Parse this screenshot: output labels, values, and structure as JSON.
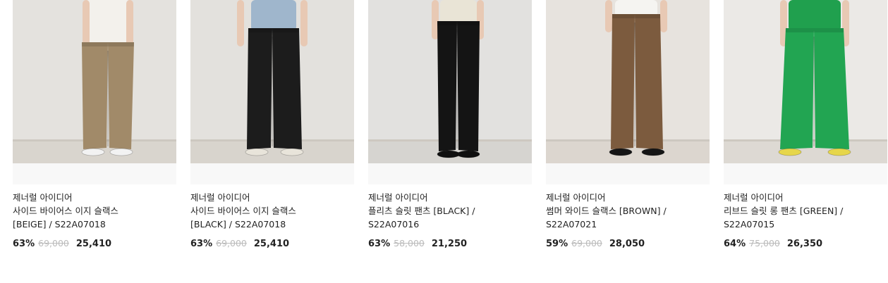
{
  "products": [
    {
      "brand": "제너럴 아이디어",
      "name": "사이드 바이어스 이지 슬랙스 [BEIGE] / S22A07018",
      "discount": "63%",
      "original_price": "69,000",
      "sale_price": "25,410",
      "bg": "#e4e2de",
      "floor": "#d9d5ce",
      "top": "#f3f1ec",
      "pants": "#a18a69",
      "shoes": "#f2f2f2"
    },
    {
      "brand": "제너럴 아이디어",
      "name": "사이드 바이어스 이지 슬랙스 [BLACK] / S22A07018",
      "discount": "63%",
      "original_price": "69,000",
      "sale_price": "25,410",
      "bg": "#e3e1dd",
      "floor": "#d8d4cd",
      "top": "#9fb6cc",
      "pants": "#1c1c1c",
      "shoes": "#e8e4da"
    },
    {
      "brand": "제너럴 아이디어",
      "name": "플리츠 슬릿 팬츠 [BLACK] / S22A07016",
      "discount": "63%",
      "original_price": "58,000",
      "sale_price": "21,250",
      "bg": "#e2e1df",
      "floor": "#d6d4d0",
      "top": "#e9e4d6",
      "pants": "#141414",
      "shoes": "#101010"
    },
    {
      "brand": "제너럴 아이디어",
      "name": "썸머 와이드 슬랙스 [BROWN] / S22A07021",
      "discount": "59%",
      "original_price": "69,000",
      "sale_price": "28,050",
      "bg": "#e7e3de",
      "floor": "#dcd6cf",
      "top": "#f5f4f1",
      "pants": "#7c5b3e",
      "shoes": "#151515"
    },
    {
      "brand": "제너럴 아이디어",
      "name": "리브드 슬릿 롱 팬츠 [GREEN] / S22A07015",
      "discount": "64%",
      "original_price": "75,000",
      "sale_price": "26,350",
      "bg": "#ebe9e6",
      "floor": "#ddd9d3",
      "top": "#20a04e",
      "pants": "#22a552",
      "shoes": "#e6d64a"
    }
  ]
}
